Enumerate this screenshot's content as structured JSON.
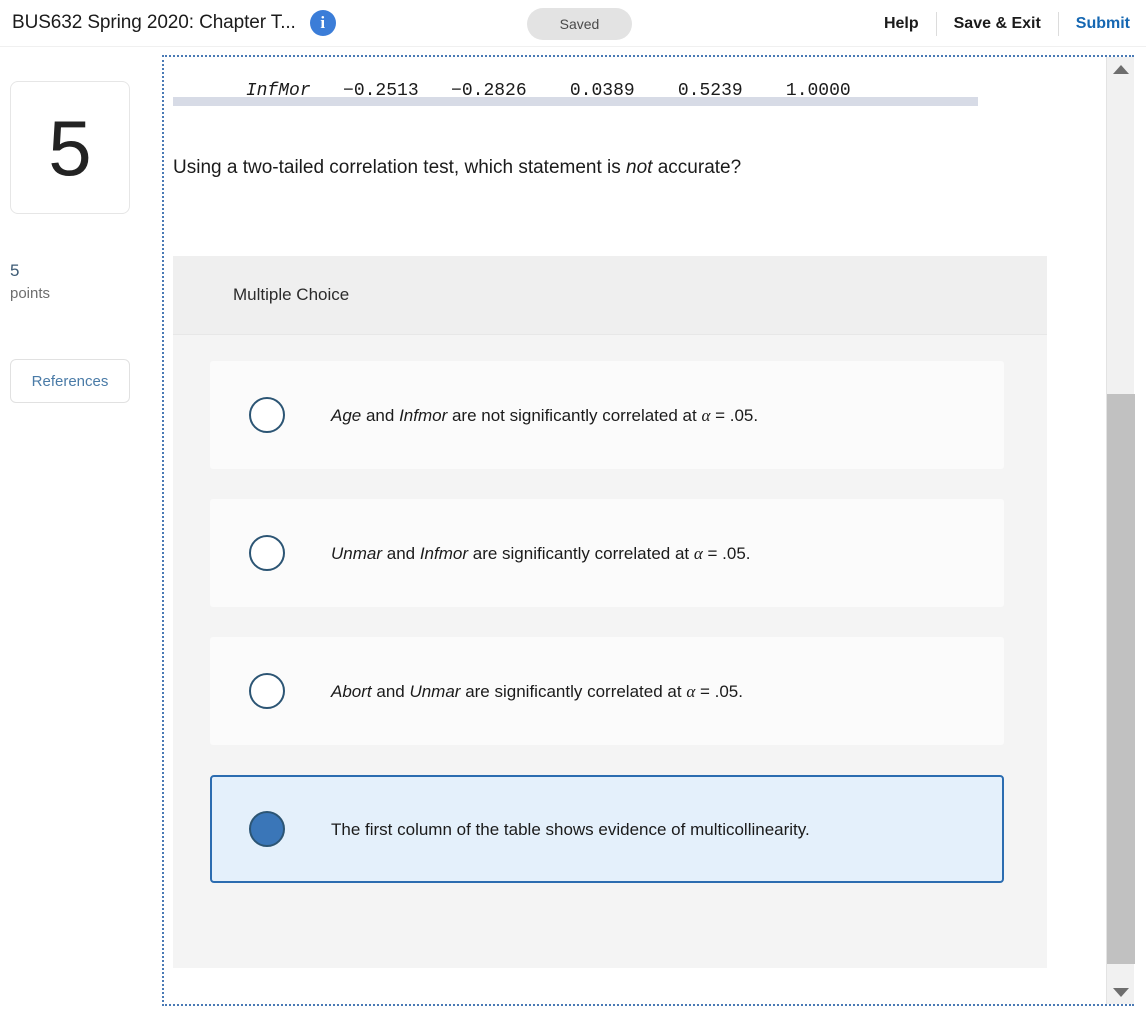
{
  "header": {
    "title": "BUS632 Spring 2020: Chapter T...",
    "info_icon": "info-icon",
    "status": "Saved",
    "help_label": "Help",
    "save_exit_label": "Save & Exit",
    "submit_label": "Submit",
    "accent_color": "#1567b2",
    "info_icon_color": "#3b7dd8"
  },
  "sidebar": {
    "question_number": "5",
    "points_value": "5",
    "points_label": "points",
    "references_label": "References",
    "references_color": "#4a7ba7"
  },
  "question": {
    "table_row": {
      "variable": "InfMor",
      "values": [
        "-0.2513",
        "-0.2826",
        "0.0389",
        "0.5239",
        "1.0000"
      ],
      "raw": "InfMor    -0.2513   -0.2826    0.0389    0.5239    1.0000"
    },
    "prompt_before": "Using a two-tailed correlation test, which statement is ",
    "prompt_emphasis": "not",
    "prompt_after": " accurate?",
    "type_label": "Multiple Choice",
    "options": [
      {
        "id": "option-a",
        "selected": false,
        "segments": [
          {
            "text": "Age",
            "italic": true
          },
          {
            "text": " and ",
            "italic": false
          },
          {
            "text": "Infmor",
            "italic": true
          },
          {
            "text": " are not significantly correlated at ",
            "italic": false
          },
          {
            "text": "α",
            "italic": true
          },
          {
            "text": " = .05.",
            "italic": false
          }
        ],
        "plain": "Age and Infmor are not significantly correlated at α = .05."
      },
      {
        "id": "option-b",
        "selected": false,
        "segments": [
          {
            "text": "Unmar",
            "italic": true
          },
          {
            "text": " and ",
            "italic": false
          },
          {
            "text": "Infmor",
            "italic": true
          },
          {
            "text": " are significantly correlated at ",
            "italic": false
          },
          {
            "text": "α",
            "italic": true
          },
          {
            "text": " = .05.",
            "italic": false
          }
        ],
        "plain": "Unmar and Infmor are significantly correlated at α = .05."
      },
      {
        "id": "option-c",
        "selected": false,
        "segments": [
          {
            "text": "Abort",
            "italic": true
          },
          {
            "text": " and ",
            "italic": false
          },
          {
            "text": "Unmar",
            "italic": true
          },
          {
            "text": " are significantly correlated at ",
            "italic": false
          },
          {
            "text": "α",
            "italic": true
          },
          {
            "text": " = .05.",
            "italic": false
          }
        ],
        "plain": "Abort and Unmar are significantly correlated at α = .05."
      },
      {
        "id": "option-d",
        "selected": true,
        "segments": [
          {
            "text": "The first column of the table shows evidence of multicollinearity.",
            "italic": false
          }
        ],
        "plain": "The first column of the table shows evidence of multicollinearity."
      }
    ],
    "selected_color": "#3a76b8",
    "selected_bg": "#e4f0fb",
    "pane_border_color": "#4a7ab5"
  },
  "scrollbars": {
    "vertical_up_icon": "chevron-up-icon",
    "vertical_down_icon": "chevron-down-icon",
    "thumb_color": "#c1c1c1",
    "horizontal_thumb_color": "#d7dbe6"
  }
}
